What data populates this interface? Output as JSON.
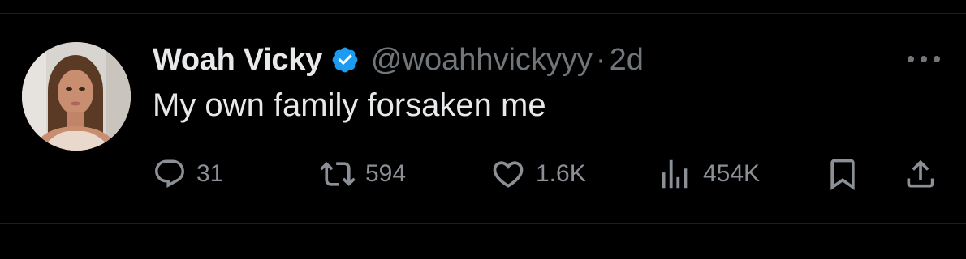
{
  "tweet": {
    "display_name": "Woah Vicky",
    "handle": "@woahhvickyyy",
    "separator": "·",
    "time": "2d",
    "text": "My own family forsaken me",
    "verified": true
  },
  "actions": {
    "replies": "31",
    "reposts": "594",
    "likes": "1.6K",
    "views": "454K"
  },
  "icons": {
    "verified": "verified-badge-icon",
    "more": "more-dots-icon",
    "reply": "reply-bubble-icon",
    "repost": "repost-arrows-icon",
    "like": "heart-icon",
    "views": "bar-chart-icon",
    "bookmark": "bookmark-icon",
    "share": "share-upload-icon"
  },
  "colors": {
    "background": "#000000",
    "text_primary": "#e7e9ea",
    "text_secondary": "#71767b",
    "icon": "#8b9096",
    "verified_blue": "#1d9bf0"
  }
}
